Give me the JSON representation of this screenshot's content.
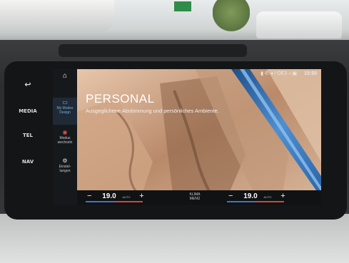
{
  "side_buttons": {
    "back_icon": "back-arrow-icon",
    "back_glyph": "↩",
    "media": "MEDIA",
    "tel": "TEL",
    "nav": "NAV"
  },
  "menu": {
    "home_icon": "home-icon",
    "home_glyph": "⌂",
    "items": [
      {
        "label_line1": "My Modes",
        "label_line2": "Design",
        "icon": "image-icon",
        "glyph": "▭"
      },
      {
        "label_line1": "Modus",
        "label_line2": "wechseln",
        "icon": "modes-icon",
        "glyph": "◉"
      },
      {
        "label_line1": "Einstel-",
        "label_line2": "lungen",
        "icon": "gear-icon",
        "glyph": "⚙"
      }
    ]
  },
  "status": {
    "text": "OE3",
    "time": "10:50",
    "icons": "▮ ✆ ◂ ! ",
    "icons_after": " ◃ ▣"
  },
  "mode": {
    "title": "PERSONAL",
    "description": "Ausgeglichene Abstimmung und persönliches Ambiente."
  },
  "climate": {
    "left_minus": "−",
    "left_temp": "19.0",
    "left_auto": "AUTO",
    "left_plus": "+",
    "klima_line1": "KLIMA",
    "klima_line2": "MENÜ",
    "right_minus": "−",
    "right_temp": "19.0",
    "right_auto": "AUTO",
    "right_plus": "+"
  }
}
